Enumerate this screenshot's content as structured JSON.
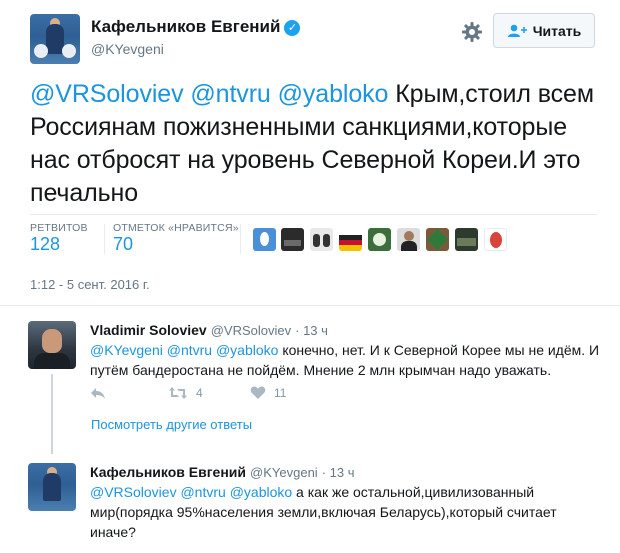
{
  "tweet": {
    "author_name": "Кафельников Евгений",
    "author_handle": "@KYevgeni",
    "follow_label": "Читать",
    "mentions": [
      "@VRSoloviev",
      "@ntvru",
      "@yabloko"
    ],
    "text": " Крым,стоил всем Россиянам пожизненными санкциями,которые нас отбросят на уровень Северной Кореи.И это печально",
    "retweets_label": "РЕТВИТОВ",
    "retweets_count": "128",
    "likes_label": "ОТМЕТОК «НРАВИТСЯ»",
    "likes_count": "70",
    "timestamp": "1:12 - 5 сент. 2016 г."
  },
  "icons": {
    "settings": "gear-icon",
    "follow": "follow-person-icon",
    "verified": "verified-badge-icon",
    "reply": "reply-icon",
    "retweet": "retweet-icon",
    "like": "heart-icon"
  },
  "likers": [
    {
      "name": "liker-1",
      "color": "#4a90d9"
    },
    {
      "name": "liker-2",
      "color": "#2b2b2b"
    },
    {
      "name": "liker-3",
      "color": "#555555"
    },
    {
      "name": "liker-4",
      "color": "#c8102e"
    },
    {
      "name": "liker-5",
      "color": "#3c6e3c"
    },
    {
      "name": "liker-6",
      "color": "#3a3a3a"
    },
    {
      "name": "liker-7",
      "color": "#7a5a3a"
    },
    {
      "name": "liker-8",
      "color": "#2e3a2e"
    },
    {
      "name": "liker-9",
      "color": "#d9453b"
    }
  ],
  "replies": [
    {
      "author_name": "Vladimir Soloviev",
      "author_handle": "@VRSoloviev",
      "time": "· 13 ч",
      "mentions": "@KYevgeni @ntvru @yabloko",
      "text": " конечно, нет. И к Северной  Корее мы не идём. И путём бандеростана не пойдём. Мнение 2 млн крымчан надо уважать.",
      "retweet_count": "4",
      "like_count": "11",
      "more_label": "Посмотреть другие ответы"
    },
    {
      "author_name": "Кафельников Евгений",
      "author_handle": "@KYevgeni",
      "time": "· 13 ч",
      "mentions": "@VRSoloviev @ntvru @yabloko",
      "text": " а как же остальной,цивилизованный мир(порядка 95%населения земли,включая Беларусь),который считает иначе?"
    }
  ],
  "colors": {
    "link": "#1b95e0",
    "text": "#14171a",
    "muted": "#657786",
    "verified": "#1da1f2"
  }
}
